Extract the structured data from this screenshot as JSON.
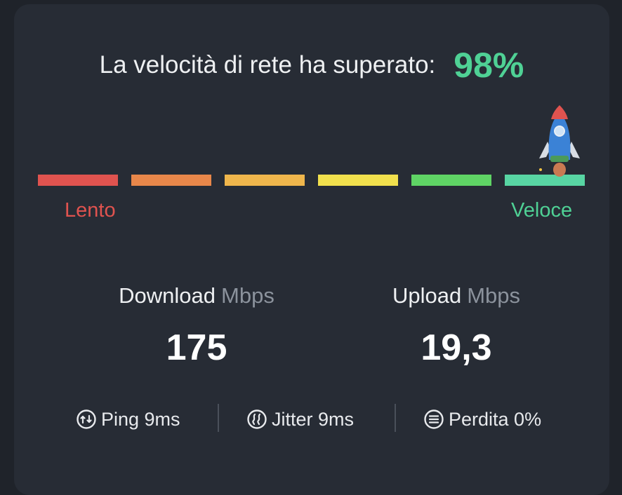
{
  "headline": {
    "text": "La velocità di rete ha superato:",
    "percent": "98%"
  },
  "scale": {
    "segments": [
      "#e0534f",
      "#e8874a",
      "#efb64c",
      "#f1e04d",
      "#5fd465",
      "#58d5a3"
    ],
    "slow_label": "Lento",
    "fast_label": "Veloce",
    "level_percent": 98
  },
  "download": {
    "label": "Download",
    "unit": "Mbps",
    "value": "175"
  },
  "upload": {
    "label": "Upload",
    "unit": "Mbps",
    "value": "19,3"
  },
  "stats": {
    "ping": {
      "icon": "ping-icon",
      "label": "Ping 9ms"
    },
    "jitter": {
      "icon": "jitter-icon",
      "label": "Jitter 9ms"
    },
    "loss": {
      "icon": "packet-loss-icon",
      "label": "Perdita 0%"
    }
  }
}
